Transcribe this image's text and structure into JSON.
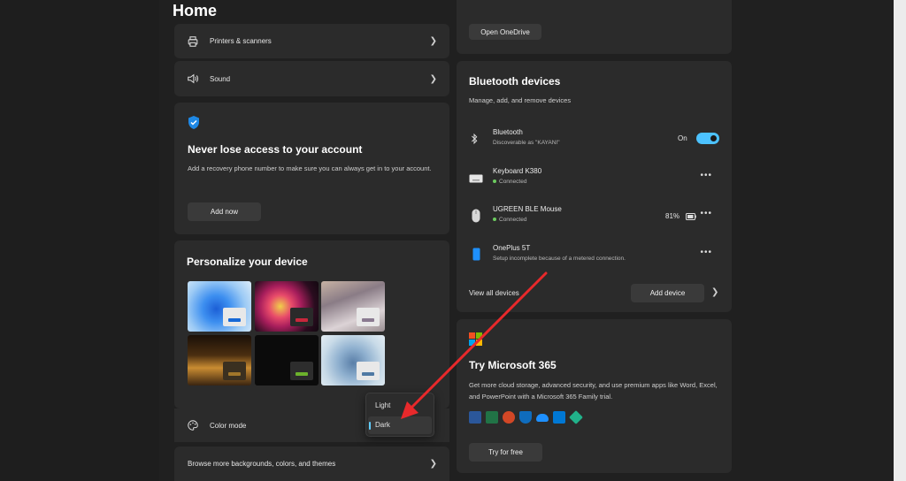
{
  "page": {
    "title": "Home"
  },
  "left_column": {
    "printers": {
      "label": "Printers & scanners",
      "icon": "printer-icon"
    },
    "sound": {
      "label": "Sound",
      "icon": "speaker-icon"
    },
    "account": {
      "icon": "shield-icon",
      "title": "Never lose access to your account",
      "description": "Add a recovery phone number to make sure you can always get in to your account.",
      "button": "Add now"
    },
    "personalize": {
      "title": "Personalize your device",
      "color_mode_label": "Color mode",
      "browse_label": "Browse more backgrounds, colors, and themes",
      "menu_options": [
        "Light",
        "Dark"
      ],
      "menu_selected": "Dark"
    }
  },
  "right_column": {
    "onedrive": {
      "button": "Open OneDrive"
    },
    "bluetooth": {
      "title": "Bluetooth devices",
      "subtitle": "Manage, add, and remove devices",
      "toggle": {
        "name": "Bluetooth",
        "status": "Discoverable as \"KAYANI\"",
        "state_label": "On",
        "on": true
      },
      "devices": [
        {
          "name": "Keyboard K380",
          "status": "Connected",
          "icon": "keyboard-icon"
        },
        {
          "name": "UGREEN BLE Mouse",
          "status": "Connected",
          "battery": "81%",
          "icon": "mouse-icon"
        },
        {
          "name": "OnePlus 5T",
          "status": "Setup incomplete because of a metered connection.",
          "icon": "phone-icon"
        }
      ],
      "view_all": "View all devices",
      "add_device": "Add device"
    },
    "m365": {
      "title": "Try Microsoft 365",
      "description": "Get more cloud storage, advanced security, and use premium apps like Word, Excel, and PowerPoint with a Microsoft 365 Family trial.",
      "button": "Try for free",
      "apps": [
        "word-icon",
        "excel-icon",
        "powerpoint-icon",
        "defender-icon",
        "onedrive-icon",
        "outlook-icon",
        "family-safety-icon"
      ]
    }
  },
  "colors": {
    "accent": "#60cdff",
    "toggle_on": "#4cc2ff",
    "annotation_arrow": "#e8292b",
    "background": "#202020",
    "card": "#2b2b2b"
  }
}
